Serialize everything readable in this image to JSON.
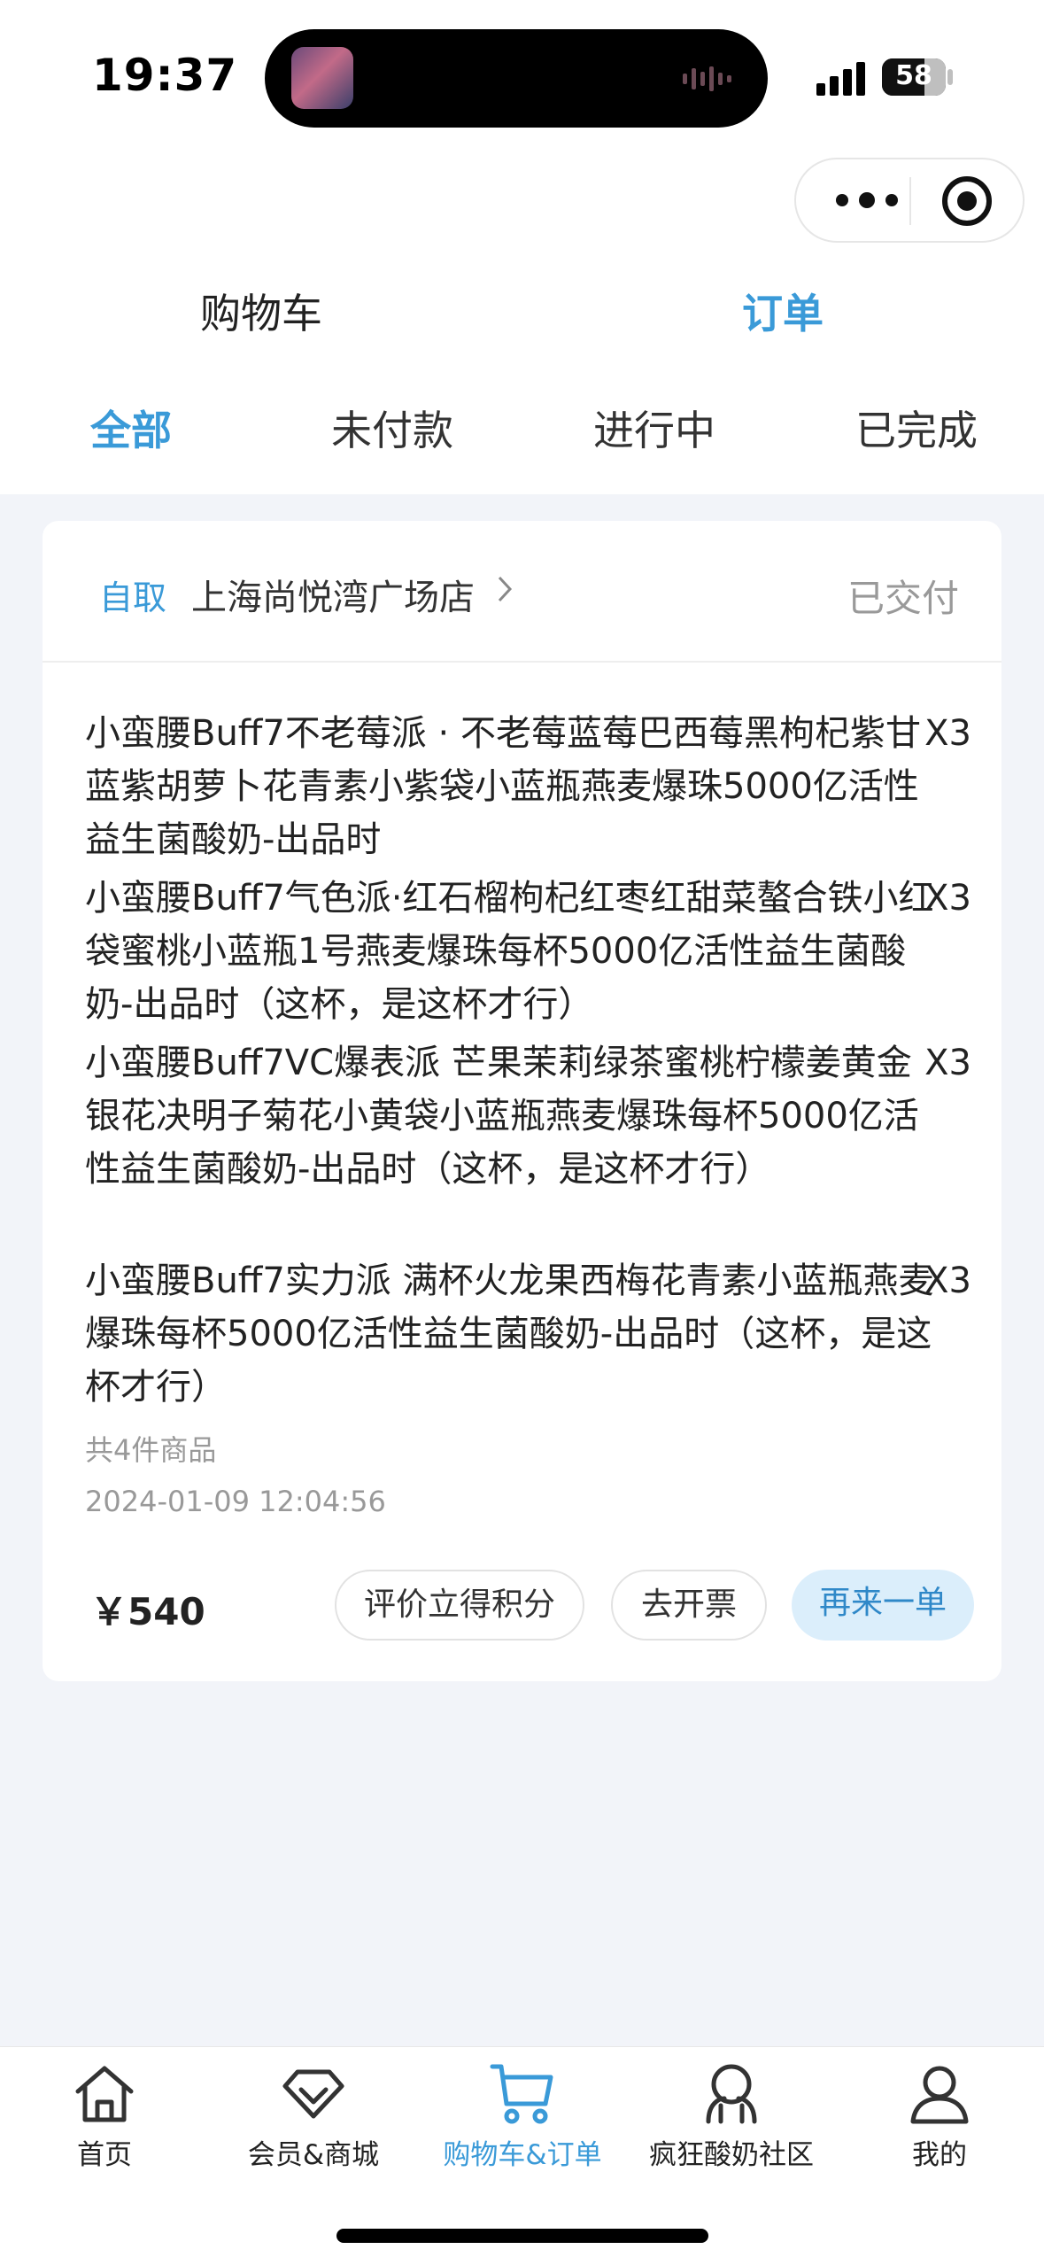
{
  "status_bar": {
    "time": "19:37",
    "battery": "58"
  },
  "top_tabs": {
    "cart": "购物车",
    "orders": "订单"
  },
  "sub_tabs": [
    "全部",
    "未付款",
    "进行中",
    "已完成"
  ],
  "order": {
    "pickup_label": "自取",
    "store_name": "上海尚悦湾广场店",
    "status": "已交付",
    "items": [
      {
        "name": "小蛮腰Buff7不老莓派 · 不老莓蓝莓巴西莓黑枸杞紫甘蓝紫胡萝卜花青素小紫袋小蓝瓶燕麦爆珠5000亿活性益生菌酸奶-出品时",
        "qty": "X3"
      },
      {
        "name": "小蛮腰Buff7气色派·红石榴枸杞红枣红甜菜螯合铁小红袋蜜桃小蓝瓶1号燕麦爆珠每杯5000亿活性益生菌酸奶-出品时（这杯，是这杯才行）",
        "qty": "X3"
      },
      {
        "name": "小蛮腰Buff7VC爆表派 芒果茉莉绿茶蜜桃柠檬姜黄金银花决明子菊花小黄袋小蓝瓶燕麦爆珠每杯5000亿活性益生菌酸奶-出品时（这杯，是这杯才行）",
        "qty": "X3"
      },
      {
        "name": "小蛮腰Buff7实力派 满杯火龙果西梅花青素小蓝瓶燕麦爆珠每杯5000亿活性益生菌酸奶-出品时（这杯，是这杯才行）",
        "qty": "X3"
      }
    ],
    "item_count": "共4件商品",
    "datetime": "2024-01-09 12:04:56",
    "price": "￥540",
    "buttons": {
      "review": "评价立得积分",
      "invoice": "去开票",
      "reorder": "再来一单"
    }
  },
  "bottom_nav": [
    {
      "label": "首页",
      "icon": "home-icon"
    },
    {
      "label": "会员&商城",
      "icon": "diamond-icon"
    },
    {
      "label": "购物车&订单",
      "icon": "cart-icon",
      "active": true
    },
    {
      "label": "疯狂酸奶社区",
      "icon": "community-icon"
    },
    {
      "label": "我的",
      "icon": "profile-icon"
    }
  ],
  "colors": {
    "accent": "#3a9ad8",
    "background": "#f2f4f9",
    "reorder_bg": "#dbeefb"
  }
}
